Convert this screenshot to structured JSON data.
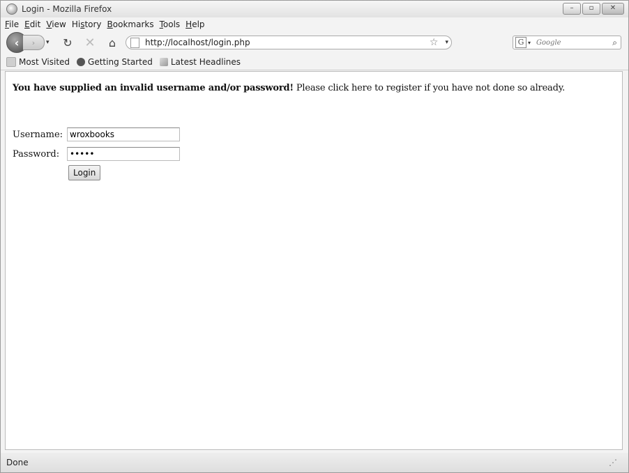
{
  "window": {
    "title": "Login - Mozilla Firefox",
    "controls": [
      "–",
      "▫",
      "✕"
    ]
  },
  "menubar": [
    {
      "key": "F",
      "rest": "ile"
    },
    {
      "key": "E",
      "rest": "dit"
    },
    {
      "key": "V",
      "rest": "iew"
    },
    {
      "pre": "Hi",
      "key": "s",
      "rest": "tory"
    },
    {
      "key": "B",
      "rest": "ookmarks"
    },
    {
      "key": "T",
      "rest": "ools"
    },
    {
      "key": "H",
      "rest": "elp"
    }
  ],
  "navbar": {
    "url": "http://localhost/login.php",
    "search_placeholder": "Google",
    "icons": {
      "back": "‹",
      "forward": "›",
      "dropdown": "▾",
      "reload": "↻",
      "stop": "✕",
      "home": "⌂",
      "star": "☆",
      "search_engine": "G",
      "search_go": "⌕"
    }
  },
  "bookmarks": [
    {
      "label": "Most Visited"
    },
    {
      "label": "Getting Started"
    },
    {
      "label": "Latest Headlines"
    }
  ],
  "page": {
    "error_bold": "You have supplied an invalid username and/or password!",
    "text_before_link": " Please ",
    "link_text": "click here",
    "text_after_link": " to register if you have not done so already.",
    "username_label": "Username:",
    "username_value": "wroxbooks",
    "password_label": "Password:",
    "password_value": "•••••",
    "login_label": "Login"
  },
  "status": {
    "text": "Done",
    "grip_icon": "⋰"
  }
}
